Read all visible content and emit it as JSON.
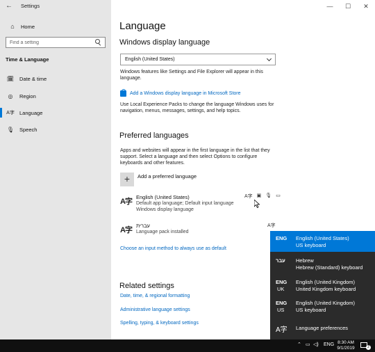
{
  "window": {
    "title": "Settings",
    "back_glyph": "←",
    "controls": [
      "—",
      "☐",
      "✕"
    ]
  },
  "sidebar": {
    "home_label": "Home",
    "search_placeholder": "Find a setting",
    "section_heading": "Time & Language",
    "items": [
      {
        "label": "Date & time",
        "icon": "calendar-clock-icon",
        "glyph": "🗓"
      },
      {
        "label": "Region",
        "icon": "globe-icon",
        "glyph": "◎"
      },
      {
        "label": "Language",
        "icon": "language-icon",
        "glyph": "A字",
        "active": true
      },
      {
        "label": "Speech",
        "icon": "microphone-icon",
        "glyph": "🎙"
      }
    ]
  },
  "main": {
    "page_title": "Language",
    "display_language": {
      "heading": "Windows display language",
      "selected": "English (United States)",
      "description": "Windows features like Settings and File Explorer will appear in this language.",
      "store_link": "Add a Windows display language in Microsoft Store",
      "lxp_text": "Use Local Experience Packs to change the language Windows uses for navigation, menus, messages, settings, and help topics."
    },
    "preferred": {
      "heading": "Preferred languages",
      "description": "Apps and websites will appear in the first language in the list that they support. Select a language and then select Options to configure keyboards and other features.",
      "add_label": "Add a preferred language",
      "languages": [
        {
          "name": "English (United States)",
          "line2": "Default app language; Default input language",
          "line3": "Windows display language",
          "feature_icons": [
            "A字",
            "▣",
            "🎙",
            "▭"
          ]
        },
        {
          "name": "עברית",
          "line2": "Language pack installed",
          "feature_icons": [
            "A字"
          ]
        }
      ],
      "input_method_link": "Choose an input method to always use as default"
    },
    "related": {
      "heading": "Related settings",
      "links": [
        "Date, time, & regional formatting",
        "Administrative language settings",
        "Spelling, typing, & keyboard settings"
      ]
    }
  },
  "flyout": {
    "items": [
      {
        "code": "ENG",
        "code2": "",
        "name": "English (United States)",
        "keyboard": "US keyboard",
        "selected": true
      },
      {
        "code": "עבר",
        "code2": "",
        "name": "Hebrew",
        "keyboard": "Hebrew (Standard) keyboard",
        "selected": false
      },
      {
        "code": "ENG",
        "code2": "UK",
        "name": "English (United Kingdom)",
        "keyboard": "United Kingdom keyboard",
        "selected": false
      },
      {
        "code": "ENG",
        "code2": "US",
        "name": "English (United Kingdom)",
        "keyboard": "US keyboard",
        "selected": false
      }
    ],
    "preferences_label": "Language preferences"
  },
  "taskbar": {
    "chevron": "⌃",
    "lang": "ENG",
    "time": "8:30 AM",
    "date": "9/1/2019",
    "notification_count": "2"
  },
  "colors": {
    "accent": "#0078d7",
    "link": "#0067c0",
    "sidebar_bg": "#e6e6e6",
    "flyout_bg": "#2b2b2b",
    "taskbar_bg": "#101010"
  }
}
